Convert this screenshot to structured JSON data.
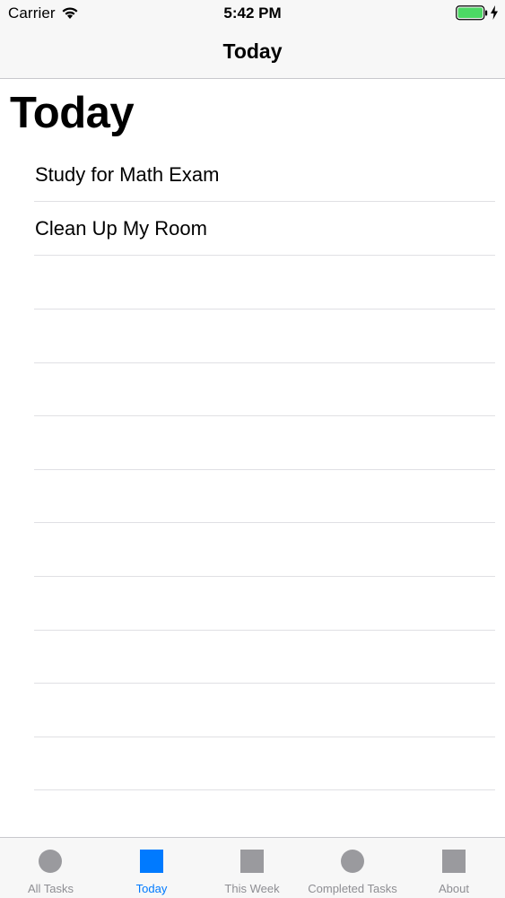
{
  "status_bar": {
    "carrier": "Carrier",
    "time": "5:42 PM",
    "icons": [
      "wifi-icon",
      "battery-icon",
      "charging-icon"
    ],
    "battery_color": "#4cd964"
  },
  "nav": {
    "title": "Today"
  },
  "header": {
    "large_title": "Today"
  },
  "tasks": [
    {
      "label": "Study for Math Exam"
    },
    {
      "label": "Clean Up My Room"
    }
  ],
  "tab_bar": {
    "selected": "Today",
    "accent_color": "#007aff",
    "inactive_color": "#8e8e93",
    "items": [
      {
        "label": "All Tasks",
        "icon": "circle-icon"
      },
      {
        "label": "Today",
        "icon": "square-icon"
      },
      {
        "label": "This Week",
        "icon": "square-icon"
      },
      {
        "label": "Completed Tasks",
        "icon": "circle-icon"
      },
      {
        "label": "About",
        "icon": "square-icon"
      }
    ]
  }
}
